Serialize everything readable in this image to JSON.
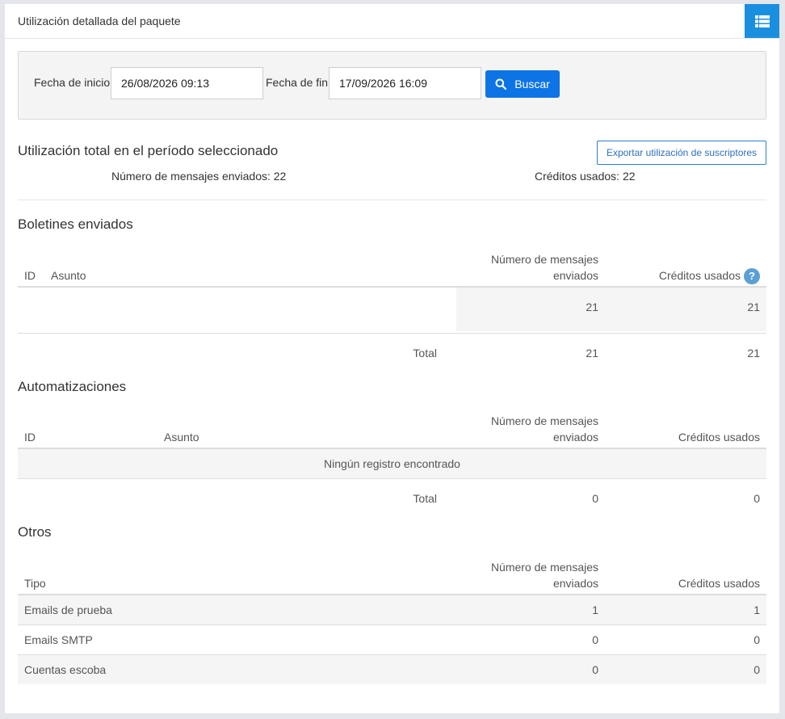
{
  "header": {
    "title": "Utilización detallada del paquete",
    "menu_icon": "list-icon"
  },
  "search": {
    "start_label": "Fecha de inicio",
    "start_value": "26/08/2026 09:13",
    "end_label": "Fecha de fin",
    "end_value": "17/09/2026 16:09",
    "button_label": "Buscar",
    "button_icon": "search-icon"
  },
  "summary": {
    "title": "Utilización total en el período seleccionado",
    "export_label": "Exportar utilización de suscriptores",
    "messages_sent": "Número de mensajes enviados: 22",
    "credits_used": "Créditos usados: 22"
  },
  "newsletters": {
    "title": "Boletines enviados",
    "col_id": "ID",
    "col_subject": "Asunto",
    "col_messages_1": "Número de mensajes",
    "col_messages_2": "enviados",
    "col_credits": "Créditos usados",
    "help_icon": "?",
    "row": {
      "messages": "21",
      "credits": "21"
    },
    "total_label": "Total",
    "total_messages": "21",
    "total_credits": "21"
  },
  "automations": {
    "title": "Automatizaciones",
    "col_id": "ID",
    "col_subject": "Asunto",
    "col_messages_1": "Número de mensajes",
    "col_messages_2": "enviados",
    "col_credits": "Créditos usados",
    "empty": "Ningún registro encontrado",
    "total_label": "Total",
    "total_messages": "0",
    "total_credits": "0"
  },
  "others": {
    "title": "Otros",
    "col_type": "Tipo",
    "col_messages_1": "Número de mensajes",
    "col_messages_2": "enviados",
    "col_credits": "Créditos usados",
    "rows": [
      {
        "type": "Emails de prueba",
        "messages": "1",
        "credits": "1"
      },
      {
        "type": "Emails SMTP",
        "messages": "0",
        "credits": "0"
      },
      {
        "type": "Cuentas escoba",
        "messages": "0",
        "credits": "0"
      }
    ]
  }
}
